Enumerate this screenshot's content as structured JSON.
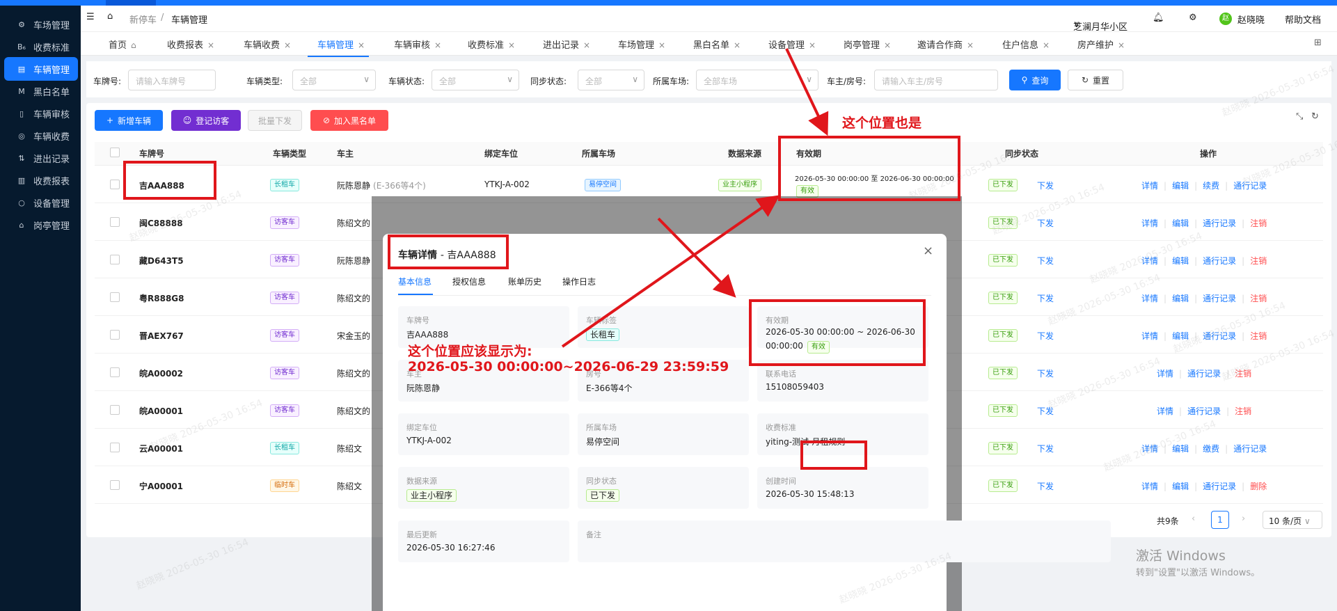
{
  "header": {
    "breadcrumb_home": "新停车",
    "breadcrumb_current": "车辆管理",
    "community": "芝澜月华小区",
    "user_avatar": "赵",
    "user": "赵晓晓",
    "help": "帮助文档"
  },
  "sidebar": [
    {
      "label": "车场管理",
      "icon": "⚙"
    },
    {
      "label": "收费标准",
      "icon": "B₆"
    },
    {
      "label": "车辆管理",
      "icon": "▤"
    },
    {
      "label": "黑白名单",
      "icon": "M"
    },
    {
      "label": "车辆审核",
      "icon": "▯"
    },
    {
      "label": "车辆收费",
      "icon": "◎"
    },
    {
      "label": "进出记录",
      "icon": "⇅"
    },
    {
      "label": "收费报表",
      "icon": "▥"
    },
    {
      "label": "设备管理",
      "icon": "○"
    },
    {
      "label": "岗亭管理",
      "icon": "⌂"
    }
  ],
  "tabs": [
    "首页",
    "收费报表",
    "车辆收费",
    "车辆管理",
    "车辆审核",
    "收费标准",
    "进出记录",
    "车场管理",
    "黑白名单",
    "设备管理",
    "岗亭管理",
    "邀请合作商",
    "住户信息",
    "房产维护"
  ],
  "filters": {
    "plate_label": "车牌号:",
    "plate_ph": "请输入车牌号",
    "type_label": "车辆类型:",
    "type_val": "全部",
    "status_label": "车辆状态:",
    "status_val": "全部",
    "sync_label": "同步状态:",
    "sync_val": "全部",
    "lot_label": "所属车场:",
    "lot_val": "全部车场",
    "owner_label": "车主/房号:",
    "owner_ph": "请输入车主/房号",
    "search": "查询",
    "reset": "重置"
  },
  "actions": {
    "add": "新增车辆",
    "visitor": "登记访客",
    "batch": "批量下发",
    "blacklist": "加入黑名单"
  },
  "columns": [
    "车牌号",
    "车辆类型",
    "车主",
    "绑定车位",
    "所属车场",
    "数据来源",
    "有效期",
    "同步状态",
    "操作"
  ],
  "rows": [
    {
      "plate": "吉AAA888",
      "type": "长租车",
      "type_color": "cyan",
      "owner": "阮陈恩静",
      "owner_extra": "(E-366等4个)",
      "slot": "YTKJ-A-002",
      "lot": "易停空间",
      "src": "业主小程序",
      "valid": "2026-05-30 00:00:00 至 2026-06-30 00:00:00",
      "valid_tag": "有效",
      "sync": "已下发",
      "dispatch": "下发",
      "ops": [
        "详情",
        "编辑",
        "续费",
        "通行记录"
      ],
      "ops_red": []
    },
    {
      "plate": "闽C88888",
      "type": "访客车",
      "type_color": "purple",
      "owner": "陈绍文的",
      "sync": "已下发",
      "dispatch": "下发",
      "ops": [
        "详情",
        "编辑",
        "通行记录"
      ],
      "ops_red": [
        "注销"
      ]
    },
    {
      "plate": "藏D643T5",
      "type": "访客车",
      "type_color": "purple",
      "owner": "阮陈恩静",
      "sync": "已下发",
      "dispatch": "下发",
      "ops": [
        "详情",
        "编辑",
        "通行记录"
      ],
      "ops_red": [
        "注销"
      ]
    },
    {
      "plate": "粤R888G8",
      "type": "访客车",
      "type_color": "purple",
      "owner": "陈绍文的",
      "sync": "已下发",
      "dispatch": "下发",
      "ops": [
        "详情",
        "编辑",
        "通行记录"
      ],
      "ops_red": [
        "注销"
      ]
    },
    {
      "plate": "晋AEX767",
      "type": "访客车",
      "type_color": "purple",
      "owner": "宋金玉的",
      "sync": "已下发",
      "dispatch": "下发",
      "ops": [
        "详情",
        "编辑",
        "通行记录"
      ],
      "ops_red": [
        "注销"
      ]
    },
    {
      "plate": "皖A00002",
      "type": "访客车",
      "type_color": "purple",
      "owner": "陈绍文的",
      "sync": "已下发",
      "dispatch": "下发",
      "ops": [
        "详情",
        "通行记录"
      ],
      "ops_red": [
        "注销"
      ]
    },
    {
      "plate": "皖A00001",
      "type": "访客车",
      "type_color": "purple",
      "owner": "陈绍文的",
      "sync": "已下发",
      "dispatch": "下发",
      "ops": [
        "详情",
        "通行记录"
      ],
      "ops_red": [
        "注销"
      ]
    },
    {
      "plate": "云A00001",
      "type": "长租车",
      "type_color": "cyan",
      "owner": "陈绍文",
      "sync": "已下发",
      "dispatch": "下发",
      "ops": [
        "详情",
        "编辑",
        "缴费",
        "通行记录"
      ],
      "ops_red": []
    },
    {
      "plate": "宁A00001",
      "type": "临时车",
      "type_color": "orange",
      "owner": "陈绍文",
      "sync": "已下发",
      "dispatch": "下发",
      "ops": [
        "详情",
        "编辑",
        "通行记录"
      ],
      "ops_red": [
        "删除"
      ]
    }
  ],
  "pagination": {
    "total": "共9条",
    "page": "1",
    "size": "10 条/页"
  },
  "modal": {
    "title": "车辆详情",
    "title_sub": "- 吉AAA888",
    "tabs": [
      "基本信息",
      "授权信息",
      "账单历史",
      "操作日志"
    ],
    "fields": [
      {
        "label": "车牌号",
        "value": "吉AAA888"
      },
      {
        "label": "车辆标签",
        "tag": "长租车"
      },
      {
        "label": "有效期",
        "value": "2026-05-30 00:00:00 ~ 2026-06-30",
        "value2": "00:00:00",
        "tag": "有效"
      },
      {
        "label": "车主",
        "value": "阮陈恩静"
      },
      {
        "label": "房号",
        "value": "E-366等4个"
      },
      {
        "label": "联系电话",
        "value": "15108059403"
      },
      {
        "label": "绑定车位",
        "value": "YTKJ-A-002"
      },
      {
        "label": "所属车场",
        "value": "易停空间"
      },
      {
        "label": "收费标准",
        "value": "yiting-测试-月租规则"
      },
      {
        "label": "数据来源",
        "tag": "业主小程序"
      },
      {
        "label": "同步状态",
        "tag": "已下发"
      },
      {
        "label": "创建时间",
        "value": "2026-05-30 15:48:13"
      },
      {
        "label": "最后更新",
        "value": "2026-05-30 16:27:46"
      },
      {
        "label": "备注",
        "value": ""
      }
    ]
  },
  "annotations": {
    "top": "这个位置也是",
    "line1": "这个位置应该显示为:",
    "line2": "2026-05-30 00:00:00~2026-06-29 23:59:59"
  },
  "watermark": "赵晓晓 2026-05-30 16:54",
  "windows": {
    "line1": "激活 Windows",
    "line2": "转到\"设置\"以激活 Windows。"
  },
  "colors": {
    "primary": "#1677ff",
    "sidebar": "#061a2e",
    "annotation": "#e0161b",
    "purple_btn": "#722ed1",
    "red_btn": "#ff4d4f"
  }
}
